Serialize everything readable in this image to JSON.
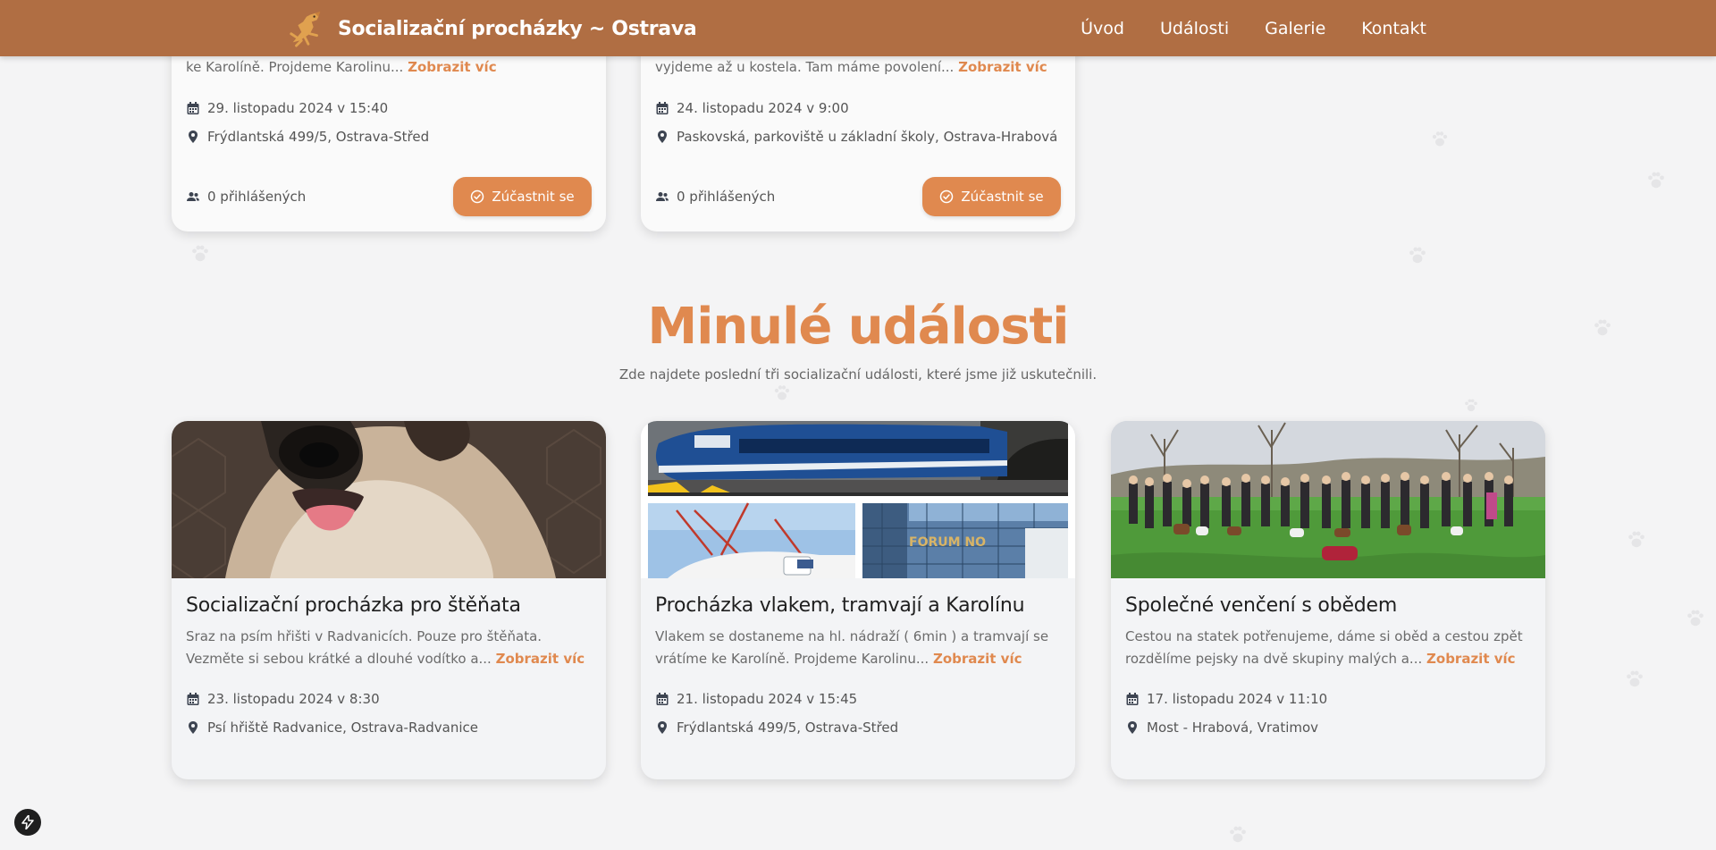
{
  "header": {
    "title": "Socializační procházky ~ Ostrava",
    "logo_icon": "dog-logo-icon",
    "nav": [
      {
        "label": "Úvod"
      },
      {
        "label": "Události"
      },
      {
        "label": "Galerie"
      },
      {
        "label": "Kontakt"
      }
    ]
  },
  "upcoming": [
    {
      "desc_visible": "ke Karolíně. Projdeme Karolinu...",
      "more": "Zobrazit víc",
      "date": "29. listopadu 2024 v 15:40",
      "location": "Frýdlantská 499/5, Ostrava-Střed",
      "attendees": "0 přihlášených",
      "button": "Zúčastnit se"
    },
    {
      "desc_visible": "vyjdeme až u kostela. Tam máme povolení...",
      "more": "Zobrazit víc",
      "date": "24. listopadu 2024 v 9:00",
      "location": "Paskovská, parkoviště u základní školy, Ostrava-Hrabová",
      "attendees": "0 přihlášených",
      "button": "Zúčastnit se"
    }
  ],
  "past_section": {
    "title": "Minulé události",
    "subtitle": "Zde najdete poslední tři socializační události, které jsme již uskutečnili."
  },
  "past": [
    {
      "title": "Socializační procházka pro štěňata",
      "desc": "Sraz na psím hřišti v Radvanicích. Pouze pro štěňata. Vezměte si sebou krátké a dlouhé vodítko a...",
      "more": "Zobrazit víc",
      "date": "23. listopadu 2024 v 8:30",
      "location": "Psí hřiště Radvanice, Ostrava-Radvanice"
    },
    {
      "title": "Procházka vlakem, tramvají a Karolínu",
      "desc": "Vlakem se dostaneme na hl. nádraží ( 6min ) a tramvají se vrátíme ke Karolíně. Projdeme Karolinu...",
      "more": "Zobrazit víc",
      "date": "21. listopadu 2024 v 15:45",
      "location": "Frýdlantská 499/5, Ostrava-Střed",
      "img_sign": "FORUM NO"
    },
    {
      "title": "Společné venčení s obědem",
      "desc": "Cestou na statek potřenujeme, dáme si oběd a cestou zpět rozdělíme pejsky na dvě skupiny malých a...",
      "more": "Zobrazit víc",
      "date": "17. listopadu 2024 v 11:10",
      "location": "Most - Hrabová, Vratimov"
    }
  ],
  "colors": {
    "header": "#b06e43",
    "accent": "#e0894f",
    "background": "#f4f4f5"
  }
}
